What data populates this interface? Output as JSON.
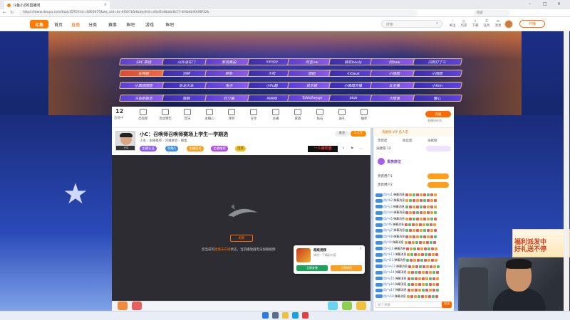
{
  "browser": {
    "tab_title": "斗鱼小Z的直播间",
    "url": "https://www.douyu.com/topic/DTG?rid=1863675&ws_uid=bc-4f307b5d&dyshid=e6af1e8bda3b17-4fdb4b40df8f32b",
    "search_placeholder": "搜索"
  },
  "site": {
    "logo": "斗鱼",
    "nav": [
      "首页",
      "直播",
      "分类",
      "赛事",
      "鱼吧",
      "游戏",
      "鱼吧"
    ],
    "search_placeholder": "搜索",
    "header_icons": [
      "关注",
      "历史",
      "下载",
      "任务",
      "消息"
    ],
    "open_live": "开播"
  },
  "banner": {
    "rows": [
      [
        "SRC·赛话",
        "山外战车门",
        "影视高拍",
        "kanjoy",
        "阿吉vw",
        "联欢bouly",
        "阿bow",
        "闪刺打了三"
      ],
      [
        "女神团",
        "刘娇",
        "胖卦",
        "大吹",
        "团团",
        "小Dauk",
        "小团团",
        "小团团"
      ],
      [
        "小黑团团团",
        "卧龙大本",
        "兔子",
        "小Pu超",
        "说东坡",
        "小黑暗天猫",
        "女主播",
        "小Kim"
      ],
      [
        "斗鱼新版本",
        "旗舰",
        "杜汀画",
        "叫哈哈",
        "ToNidheygs",
        "btds",
        "大暗语",
        "暖心"
      ]
    ]
  },
  "toolbar": {
    "count": "12",
    "count_label": "直播中",
    "tools": [
      "出现新",
      "活动预告",
      "音乐",
      "主播心",
      "领奖",
      "分享",
      "主播",
      "家族",
      "钻石",
      "送礼",
      "抽奖"
    ],
    "charge_label": "充值",
    "charge_sub": "直播间任务"
  },
  "stream": {
    "streamer_short": "小C",
    "title": "小C：召唤师召唤师赛场上学生一学期选",
    "subline": "小主 · 主播推荐 · 闪播联合 · 搜集",
    "badges": [
      "主播认证",
      "等级5",
      "主播任务",
      "主播推荐",
      "活跃"
    ],
    "follow_label": "关注",
    "follow_count": "2.4万",
    "ad_text": "一人我饮酒",
    "error_button": "刷新",
    "error_message_pre": "您当前的",
    "error_message_link": "直播未开播",
    "error_message_post": "状态，当前播放器无法加载视频"
  },
  "popup": {
    "title": "超级视频",
    "subtitle": "体验一下精彩内容",
    "button_primary": "立即安装",
    "button_secondary": "立即体验",
    "close": "×"
  },
  "chat": {
    "header": "贡献榜 VIP 名人堂",
    "tabs": [
      "贵宾席",
      "粉丝团",
      "贡献榜"
    ],
    "rank_label": "贡献值 12",
    "noble_title": "贵族席位",
    "noble_users": [
      "贵宾用户1",
      "贵宾用户2"
    ],
    "messages": [
      {
        "name": "用户a1",
        "text": "弹幕消息"
      },
      {
        "name": "用户b2",
        "text": "弹幕消息"
      },
      {
        "name": "用户c3",
        "text": "弹幕消息"
      },
      {
        "name": "用户d4",
        "text": "弹幕消息"
      },
      {
        "name": "用户e5",
        "text": "弹幕消息"
      },
      {
        "name": "用户f6",
        "text": "弹幕消息"
      },
      {
        "name": "用户g7",
        "text": "弹幕消息"
      },
      {
        "name": "用户h8",
        "text": "弹幕消息"
      },
      {
        "name": "用户i9",
        "text": "弹幕消息"
      },
      {
        "name": "用户j10",
        "text": "弹幕消息"
      },
      {
        "name": "用户k11",
        "text": "弹幕消息"
      },
      {
        "name": "用户l12",
        "text": "弹幕消息"
      },
      {
        "name": "用户m13",
        "text": "弹幕消息"
      },
      {
        "name": "用户n14",
        "text": "弹幕消息"
      },
      {
        "name": "用户o15",
        "text": "弹幕消息"
      },
      {
        "name": "用户p16",
        "text": "弹幕消息"
      },
      {
        "name": "用户q17",
        "text": "弹幕消息"
      },
      {
        "name": "用户r18",
        "text": "弹幕消息"
      }
    ],
    "input_placeholder": "发个弹幕",
    "send": "发送"
  },
  "promo": {
    "text_line1": "福利派发中",
    "text_line2": "好礼送不停"
  },
  "colors": {
    "accent": "#ff6a00",
    "banner_purple": "#5b3fd6",
    "video_bg": "#2c2c32"
  }
}
